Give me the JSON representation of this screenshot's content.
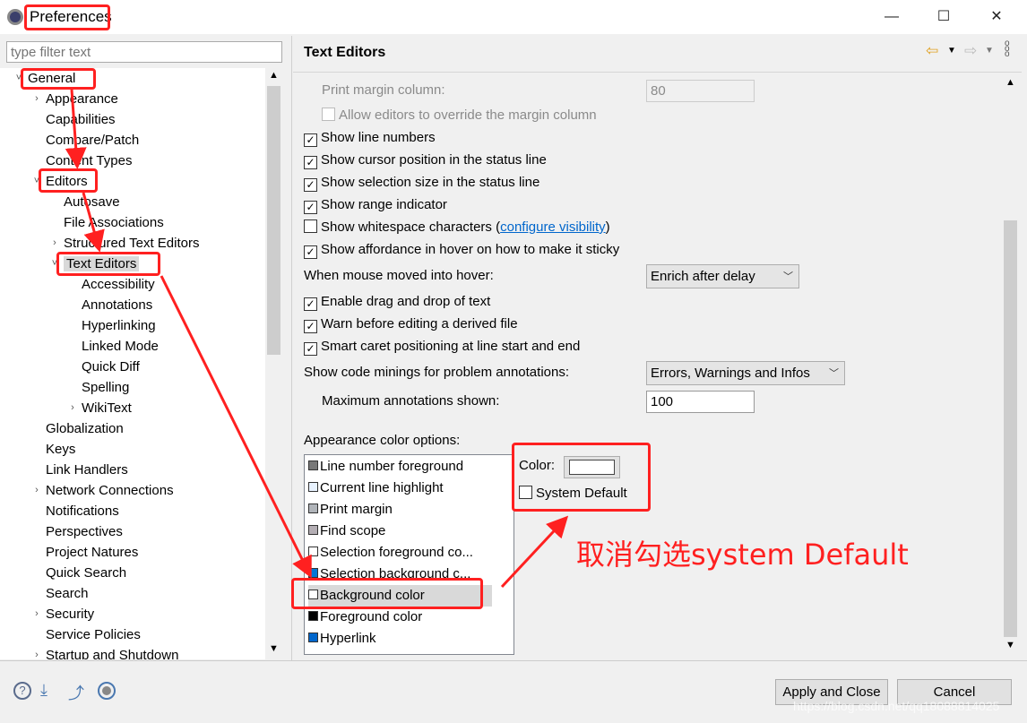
{
  "window": {
    "title": "Preferences",
    "minimize": "—",
    "maximize": "☐",
    "close": "✕"
  },
  "filter": {
    "placeholder": "type filter text"
  },
  "tree": [
    {
      "label": "General",
      "level": 0,
      "exp": "˅"
    },
    {
      "label": "Appearance",
      "level": 1,
      "exp": "›"
    },
    {
      "label": "Capabilities",
      "level": 1,
      "exp": ""
    },
    {
      "label": "Compare/Patch",
      "level": 1,
      "exp": ""
    },
    {
      "label": "Content Types",
      "level": 1,
      "exp": ""
    },
    {
      "label": "Editors",
      "level": 1,
      "exp": "˅"
    },
    {
      "label": "Autosave",
      "level": 2,
      "exp": ""
    },
    {
      "label": "File Associations",
      "level": 2,
      "exp": ""
    },
    {
      "label": "Structured Text Editors",
      "level": 2,
      "exp": "›"
    },
    {
      "label": "Text Editors",
      "level": 2,
      "exp": "˅",
      "selected": true
    },
    {
      "label": "Accessibility",
      "level": 3,
      "exp": ""
    },
    {
      "label": "Annotations",
      "level": 3,
      "exp": ""
    },
    {
      "label": "Hyperlinking",
      "level": 3,
      "exp": ""
    },
    {
      "label": "Linked Mode",
      "level": 3,
      "exp": ""
    },
    {
      "label": "Quick Diff",
      "level": 3,
      "exp": ""
    },
    {
      "label": "Spelling",
      "level": 3,
      "exp": ""
    },
    {
      "label": "WikiText",
      "level": 3,
      "exp": "›"
    },
    {
      "label": "Globalization",
      "level": 1,
      "exp": ""
    },
    {
      "label": "Keys",
      "level": 1,
      "exp": ""
    },
    {
      "label": "Link Handlers",
      "level": 1,
      "exp": ""
    },
    {
      "label": "Network Connections",
      "level": 1,
      "exp": "›"
    },
    {
      "label": "Notifications",
      "level": 1,
      "exp": ""
    },
    {
      "label": "Perspectives",
      "level": 1,
      "exp": ""
    },
    {
      "label": "Project Natures",
      "level": 1,
      "exp": ""
    },
    {
      "label": "Quick Search",
      "level": 1,
      "exp": ""
    },
    {
      "label": "Search",
      "level": 1,
      "exp": ""
    },
    {
      "label": "Security",
      "level": 1,
      "exp": "›"
    },
    {
      "label": "Service Policies",
      "level": 1,
      "exp": ""
    },
    {
      "label": "Startup and Shutdown",
      "level": 1,
      "exp": "›"
    }
  ],
  "page": {
    "title": "Text Editors",
    "print_margin_label": "Print margin column:",
    "print_margin_value": "80",
    "allow_override": "Allow editors to override the margin column",
    "checks": [
      {
        "label": "Show line numbers",
        "checked": true
      },
      {
        "label": "Show cursor position in the status line",
        "checked": true
      },
      {
        "label": "Show selection size in the status line",
        "checked": true
      },
      {
        "label": "Show range indicator",
        "checked": true
      },
      {
        "label": "Show whitespace characters",
        "checked": false,
        "link": "configure visibility"
      },
      {
        "label": "Show affordance in hover on how to make it sticky",
        "checked": true
      }
    ],
    "hover_label": "When mouse moved into hover:",
    "hover_value": "Enrich after delay",
    "checks2": [
      {
        "label": "Enable drag and drop of text",
        "checked": true
      },
      {
        "label": "Warn before editing a derived file",
        "checked": true
      },
      {
        "label": "Smart caret positioning at line start and end",
        "checked": true
      }
    ],
    "minings_label": "Show code minings for problem annotations:",
    "minings_value": "Errors, Warnings and Infos",
    "max_ann_label": "Maximum annotations shown:",
    "max_ann_value": "100",
    "appearance_label": "Appearance color options:",
    "colors": [
      {
        "label": "Line number foreground",
        "color": "#787878"
      },
      {
        "label": "Current line highlight",
        "color": "#e8f2fe"
      },
      {
        "label": "Print margin",
        "color": "#b0b4b9"
      },
      {
        "label": "Find scope",
        "color": "#b4aeb4"
      },
      {
        "label": "Selection foreground co...",
        "color": "#ffffff"
      },
      {
        "label": "Selection background c...",
        "color": "#0078d7"
      },
      {
        "label": "Background color",
        "color": "#ffffff",
        "selected": true
      },
      {
        "label": "Foreground color",
        "color": "#000000"
      },
      {
        "label": "Hyperlink",
        "color": "#0066cc"
      }
    ],
    "color_label": "Color:",
    "color_value": "#ffffff",
    "system_default": "System Default",
    "system_default_checked": false
  },
  "footer": {
    "apply_close": "Apply and Close",
    "cancel": "Cancel",
    "watermark": "https://blog.csdn.net/qq18088814025"
  },
  "annotation": {
    "note": "取消勾选system Default",
    "color": "#ff2020"
  }
}
